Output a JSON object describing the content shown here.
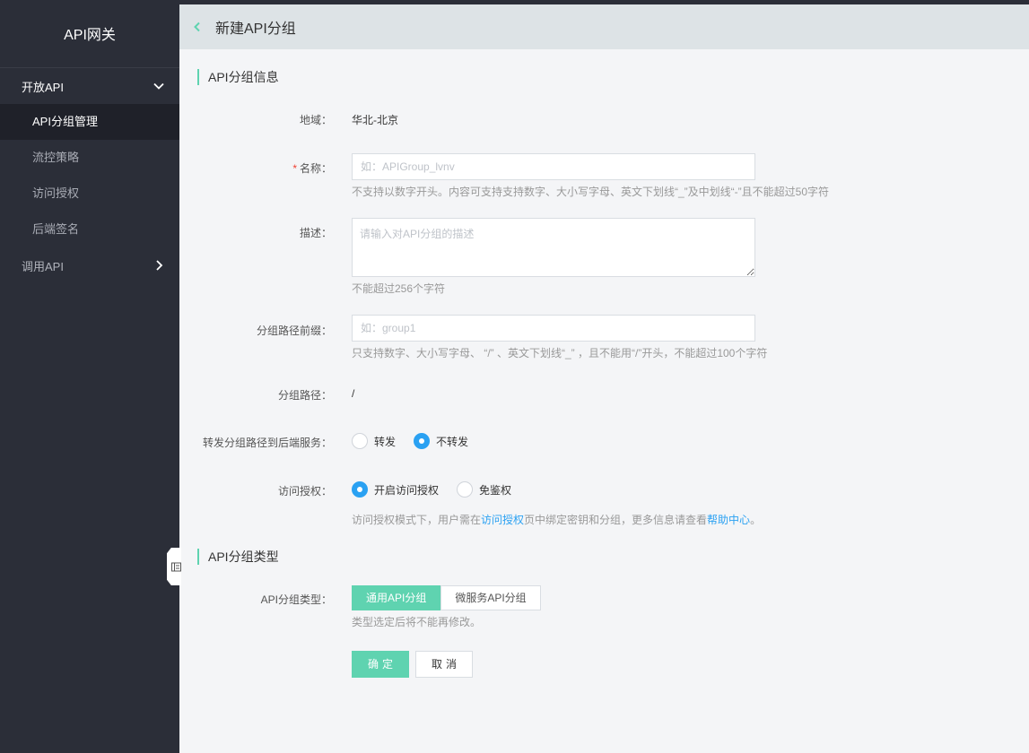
{
  "sidebar": {
    "title": "API网关",
    "groups": [
      {
        "label": "开放API",
        "expanded": true,
        "items": [
          "API分组管理",
          "流控策略",
          "访问授权",
          "后端签名"
        ],
        "active_item": "API分组管理"
      },
      {
        "label": "调用API",
        "expanded": false
      }
    ]
  },
  "header": {
    "title": "新建API分组",
    "back_icon": "chevron-left-icon"
  },
  "form": {
    "section1_title": "API分组信息",
    "region": {
      "label": "地域：",
      "value": "华北-北京"
    },
    "name": {
      "required_mark": "*",
      "label": "名称：",
      "value": "",
      "placeholder": "如：APIGroup_lvnv",
      "hint": "不支持以数字开头。内容可支持支持数字、大小写字母、英文下划线“_”及中划线“-”且不能超过50字符"
    },
    "description": {
      "label": "描述：",
      "value": "",
      "placeholder": "请输入对API分组的描述",
      "hint": "不能超过256个字符"
    },
    "path_prefix": {
      "label": "分组路径前缀：",
      "value": "",
      "placeholder": "如：group1",
      "hint": "只支持数字、大小写字母、 “/” 、英文下划线“_” ，且不能用“/”开头，不能超过100个字符"
    },
    "path": {
      "label": "分组路径：",
      "value": "/"
    },
    "forward": {
      "label": "转发分组路径到后端服务：",
      "options": [
        "转发",
        "不转发"
      ],
      "selected": "不转发"
    },
    "auth": {
      "label": "访问授权：",
      "options": [
        "开启访问授权",
        "免鉴权"
      ],
      "selected": "开启访问授权",
      "hint_prefix": "访问授权模式下，用户需在",
      "hint_link1": "访问授权",
      "hint_middle": "页中绑定密钥和分组，更多信息请查看",
      "hint_link2": "帮助中心",
      "hint_suffix": "。"
    },
    "section2_title": "API分组类型",
    "group_type": {
      "label": "API分组类型：",
      "options": [
        "通用API分组",
        "微服务API分组"
      ],
      "selected": "通用API分组",
      "hint": "类型选定后将不能再修改。"
    },
    "confirm_label": "确定",
    "cancel_label": "取消"
  },
  "colors": {
    "accent": "#5fd3b0",
    "link": "#2aa1f2",
    "sidebar_bg": "#2b2e38"
  }
}
